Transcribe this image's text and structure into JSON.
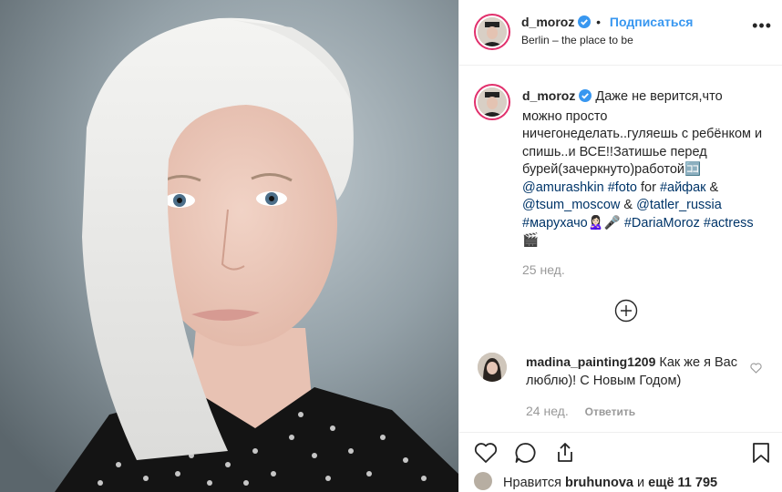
{
  "post": {
    "author": "d_moroz",
    "follow_label": "Подписаться",
    "location": "Berlin – the place to be",
    "more_label": "•••"
  },
  "caption": {
    "author": "d_moroz",
    "text_1": "Даже не верится,что можно просто ничегонеделать..гуляешь с ребёнком и спишь..и ВСЕ!!Затишье перед бурей(зачеркнуто)работой🈁",
    "tag_1": "@amurashkin",
    "tag_2": "#foto",
    "text_2": "for",
    "tag_3": "#айфак",
    "text_3": "&",
    "tag_4": "@tsum_moscow",
    "text_4": "&",
    "tag_5": "@tatler_russia",
    "tag_6": "#марухачо",
    "text_5": "🙎🏻‍♀️🎤",
    "tag_7": "#DariaMoroz",
    "tag_8": "#actress",
    "text_6": "🎬",
    "time": "25 нед."
  },
  "comment": {
    "author": "madina_painting1209",
    "text": "Как же я Вас люблю)! С Новым Годом)",
    "time": "24 нед.",
    "reply_label": "Ответить"
  },
  "likes": {
    "prefix": "Нравится",
    "user": "bruhunova",
    "middle": "и",
    "count": "ещё 11 795"
  },
  "icons": {
    "verified_color": "#3897f0",
    "ring_color": "#e1306c"
  }
}
